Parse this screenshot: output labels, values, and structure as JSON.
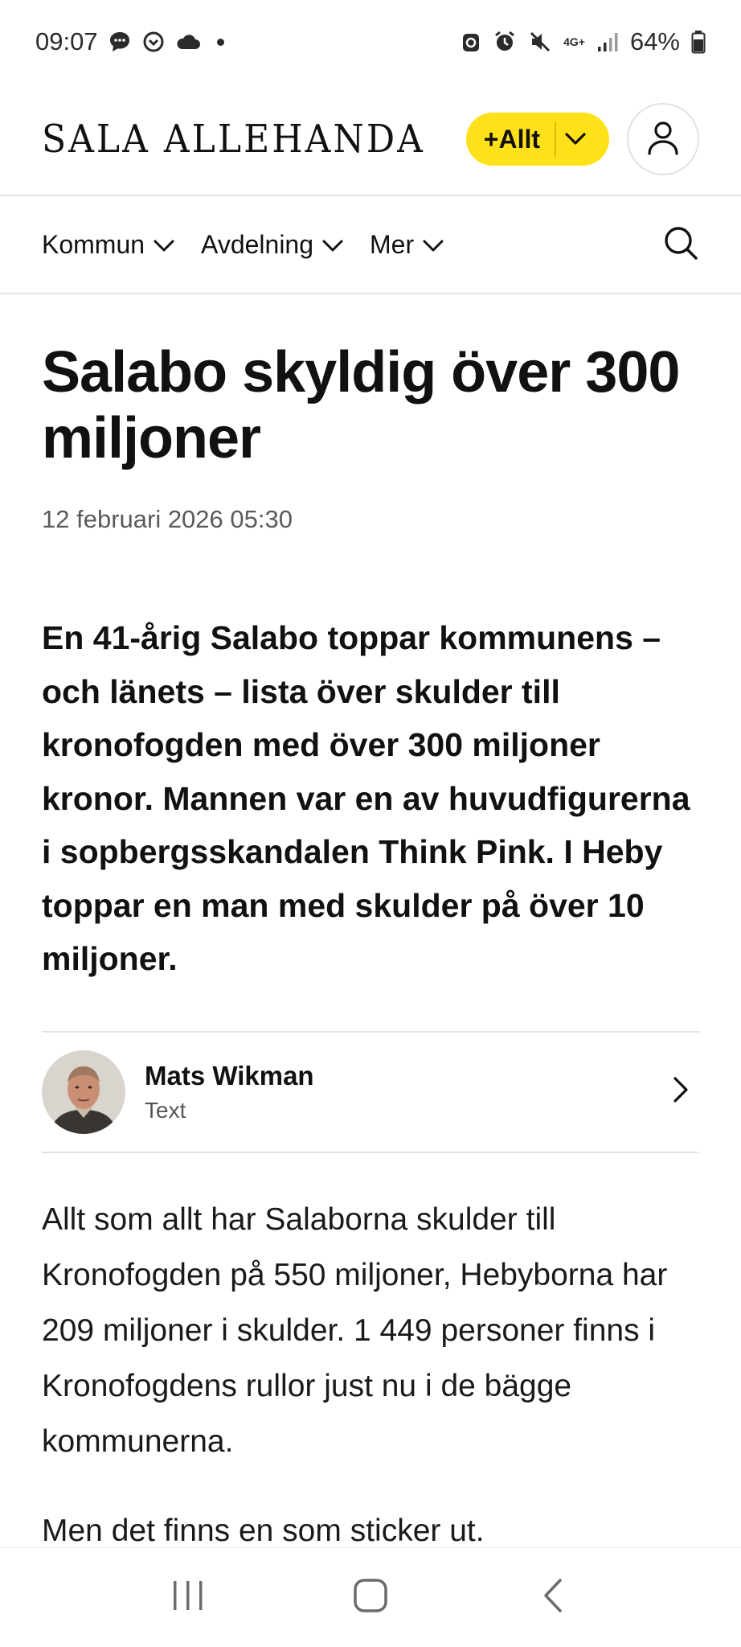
{
  "status_bar": {
    "time": "09:07",
    "network": "4G+",
    "battery": "64%"
  },
  "header": {
    "logo": "SALA ALLEHANDA",
    "allt_button": "+Allt",
    "accent_color": "#ffe11a"
  },
  "nav": {
    "items": [
      {
        "label": "Kommun"
      },
      {
        "label": "Avdelning"
      },
      {
        "label": "Mer"
      }
    ]
  },
  "article": {
    "headline": "Salabo skyldig över 300 miljoner",
    "date": "12 februari 2026 05:30",
    "lead": "En 41-årig Salabo toppar kommunens – och länets – lista över skulder till kronofogden med över 300 miljoner kronor. Mannen var en av huvudfigurerna i sopbergsskandalen Think Pink. I Heby toppar en man med skulder på över 10 miljoner.",
    "author": {
      "name": "Mats Wikman",
      "role": "Text"
    },
    "paragraphs": [
      "Allt som allt har Salaborna skulder till Kronofogden på 550 miljoner, Hebyborna har 209 miljoner i skulder. 1 449 personer finns i Kronofogdens rullor just nu i de bägge kommunerna.",
      "Men det finns en som sticker ut."
    ]
  }
}
